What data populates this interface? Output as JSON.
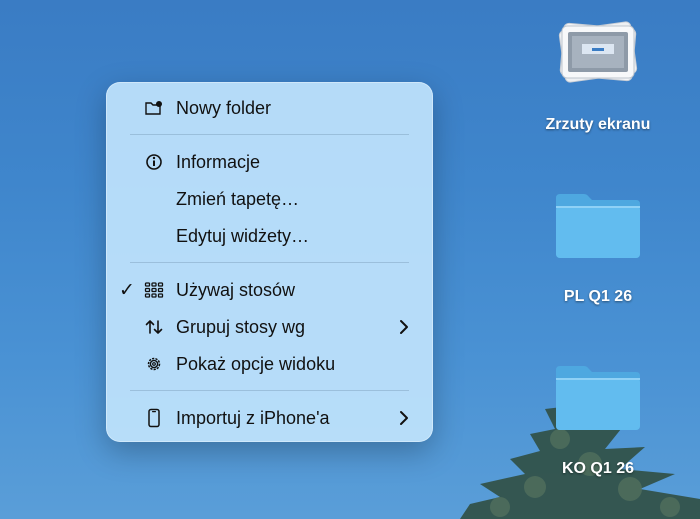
{
  "menu": {
    "items": [
      {
        "label": "Nowy folder",
        "icon": "folder-badge-icon"
      },
      {
        "label": "Informacje",
        "icon": "info-icon"
      },
      {
        "label": "Zmień tapetę…"
      },
      {
        "label": "Edytuj widżety…"
      },
      {
        "label": "Używaj stosów",
        "icon": "stacks-icon",
        "checked": true
      },
      {
        "label": "Grupuj stosy wg",
        "icon": "sort-arrows-icon",
        "submenu": true
      },
      {
        "label": "Pokaż opcje widoku",
        "icon": "gear-icon"
      },
      {
        "label": "Importuj z iPhone'a",
        "icon": "iphone-icon",
        "submenu": true
      }
    ],
    "check_mark": "✓"
  },
  "desktop": {
    "icons": [
      {
        "label": "Zrzuty ekranu",
        "type": "screenshots-stack-icon"
      },
      {
        "label": "PL Q1 26",
        "type": "folder-icon"
      },
      {
        "label": "KO Q1 26",
        "type": "folder-icon"
      }
    ]
  },
  "colors": {
    "menu_bg": "#bee2fc",
    "wallpaper": "#3f86cc",
    "folder": "#5fb7ec"
  }
}
